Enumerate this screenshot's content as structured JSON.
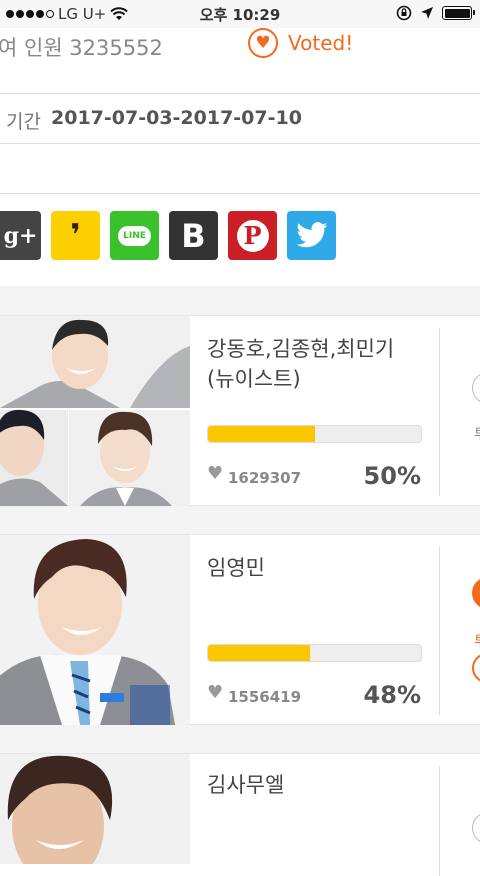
{
  "status_bar": {
    "carrier": "LG U+",
    "time": "오후 10:29"
  },
  "header": {
    "participants_text": "여 인원 3235552",
    "voted_label": "Voted!",
    "period_label": "기간",
    "period_value": "2017-07-03-2017-07-10"
  },
  "share": {
    "items": [
      {
        "name": "google-plus",
        "label": "g+"
      },
      {
        "name": "kakaostory",
        "label": "❜"
      },
      {
        "name": "line",
        "label": "LINE"
      },
      {
        "name": "band",
        "label": "B"
      },
      {
        "name": "pinterest",
        "label": "P"
      },
      {
        "name": "twitter",
        "label": "twitter"
      }
    ]
  },
  "candidates": [
    {
      "name": "강동호,김종현,최민기(뉴이스트)",
      "votes": "1629307",
      "percent": "50%",
      "progress": 0.5,
      "voted": false,
      "side_label": "투"
    },
    {
      "name": "임영민",
      "votes": "1556419",
      "percent": "48%",
      "progress": 0.48,
      "voted": true,
      "side_label": "투"
    },
    {
      "name": "김사무엘",
      "votes": "",
      "percent": "",
      "progress": 0,
      "voted": false,
      "side_label": ""
    }
  ],
  "colors": {
    "accent": "#f26a1b",
    "progress": "#fbc800"
  }
}
